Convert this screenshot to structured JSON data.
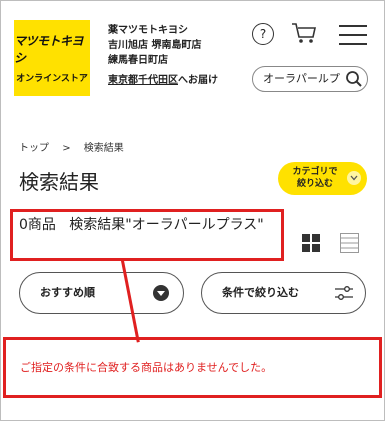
{
  "logo": {
    "line1": "マツモトキヨシ",
    "line2": "オンラインストア"
  },
  "header": {
    "store_lines": [
      "薬マツモトキヨシ",
      "吉川旭店 堺南島町店",
      "練馬春日町店"
    ],
    "delivery_area": "東京都千代田区",
    "delivery_suffix": "へお届け",
    "help_symbol": "?",
    "search_value": "オーラパールプ"
  },
  "breadcrumb": [
    "トップ",
    ">",
    "検索結果"
  ],
  "page_title": "検索結果",
  "category_button": {
    "line1": "カテゴリで",
    "line2": "絞り込む"
  },
  "results": {
    "count_text": "0商品",
    "query_text": "検索結果\"オーラパールプラス\""
  },
  "sort_button": {
    "label": "おすすめ順"
  },
  "filter_button": {
    "label": "条件で絞り込む"
  },
  "empty_message": "ご指定の条件に合致する商品はありませんでした。",
  "colors": {
    "brand_yellow": "#ffe100",
    "highlight_red": "#e02020"
  }
}
